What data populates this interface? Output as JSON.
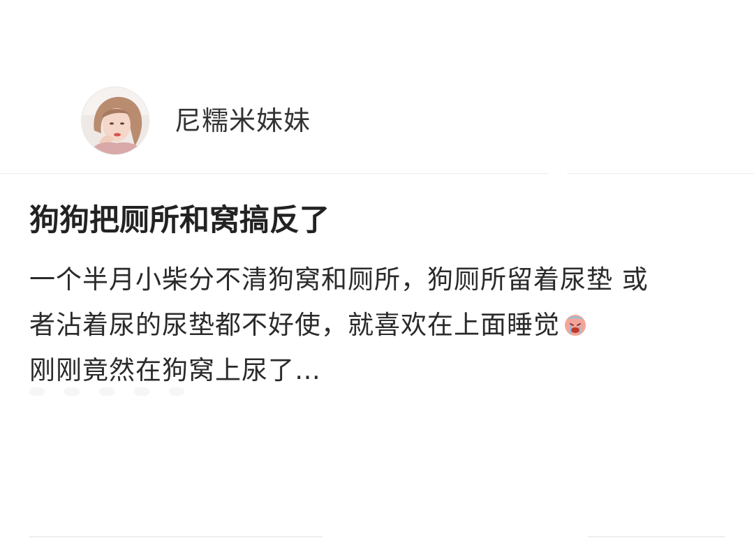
{
  "header": {
    "username": "尼糯米妹妹",
    "avatar_icon": "user-avatar-photo"
  },
  "post": {
    "title": "狗狗把厕所和窝搞反了",
    "body_lines": [
      "一个半月小柴分不清狗窝和厕所，狗厕所留着尿垫 或",
      "者沾着尿的尿垫都不好使，就喜欢在上面睡觉",
      "刚刚竟然在狗窝上尿了…"
    ],
    "emoji_icon": "crying-face-emoji"
  },
  "colors": {
    "background": "#ffffff",
    "text_primary": "#222222",
    "divider": "#ececec"
  }
}
